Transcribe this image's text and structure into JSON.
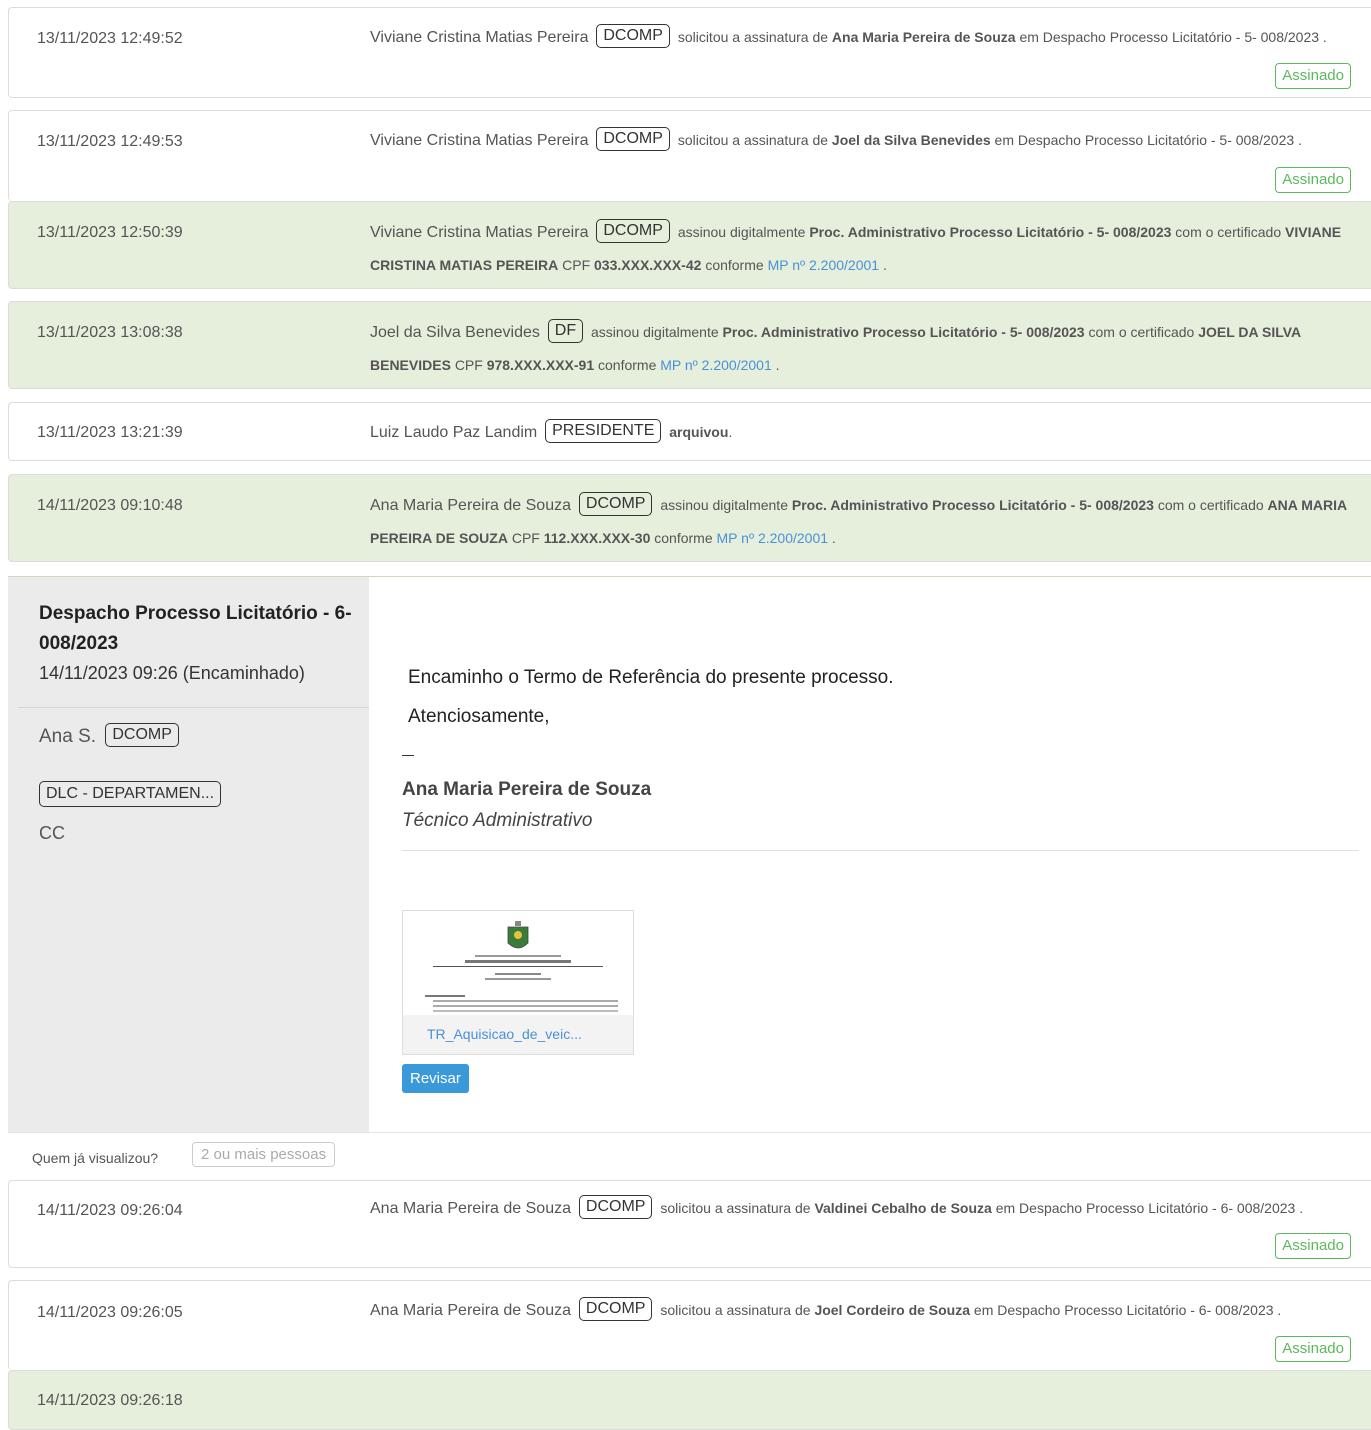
{
  "rows_top": [
    {
      "date": "13/11/2023 12:49:52",
      "name": "Viviane Cristina Matias Pereira",
      "tag": "DCOMP",
      "text1": "solicitou a assinatura de",
      "bold1": "Ana Maria Pereira de Souza",
      "text2": "em Despacho Processo Licitatório - 5- 008/2023 .",
      "badge": "Assinado"
    },
    {
      "date": "13/11/2023 12:49:53",
      "name": "Viviane Cristina Matias Pereira",
      "tag": "DCOMP",
      "text1": "solicitou a assinatura de",
      "bold1": "Joel da Silva Benevides",
      "text2": "em Despacho Processo Licitatório - 5- 008/2023 .",
      "badge": "Assinado"
    },
    {
      "date": "13/11/2023 12:50:39",
      "name": "Viviane Cristina Matias Pereira",
      "tag": "DCOMP",
      "text1": "assinou digitalmente",
      "bold1": "Proc. Administrativo Processo Licitatório - 5- 008/2023",
      "text2": "com o certificado",
      "bold2": "VIVIANE CRISTINA MATIAS PEREIRA",
      "text3": "CPF",
      "bold3": "033.XXX.XXX-42",
      "text4": "conforme",
      "link": "MP nº 2.200/2001",
      "text5": "."
    },
    {
      "date": "13/11/2023 13:08:38",
      "name": "Joel da Silva Benevides",
      "tag": "DF",
      "text1": "assinou digitalmente",
      "bold1": "Proc. Administrativo Processo Licitatório - 5- 008/2023",
      "text2": "com o certificado",
      "bold2": "JOEL DA SILVA BENEVIDES",
      "text3": "CPF",
      "bold3": "978.XXX.XXX-91",
      "text4": "conforme",
      "link": "MP nº 2.200/2001",
      "text5": "."
    },
    {
      "date": "13/11/2023 13:21:39",
      "name": "Luiz Laudo Paz Landim",
      "tag": "PRESIDENTE",
      "bold1": "arquivou",
      "text2": "."
    },
    {
      "date": "14/11/2023 09:10:48",
      "name": "Ana Maria Pereira de Souza",
      "tag": "DCOMP",
      "text1": "assinou digitalmente",
      "bold1": "Proc. Administrativo Processo Licitatório - 5- 008/2023",
      "text2": "com o certificado",
      "bold2": "ANA MARIA PEREIRA DE SOUZA",
      "text3": "CPF",
      "bold3": "112.XXX.XXX-30",
      "text4": "conforme",
      "link": "MP nº 2.200/2001",
      "text5": "."
    }
  ],
  "card": {
    "title": "Despacho Processo Licitatório - 6- 008/2023",
    "datetime": "14/11/2023 09:26 (Encaminhado)",
    "author": "Ana S.",
    "author_tag": "DCOMP",
    "dept": "DLC - DEPARTAMEN...",
    "cc": "CC",
    "para1": "Encaminho o Termo de Referência do presente processo.",
    "para2": "Atenciosamente,",
    "sig_name": "Ana Maria Pereira de Souza",
    "sig_role": "Técnico Administrativo",
    "attachment": "TR_Aquisicao_de_veic...",
    "review_button": "Revisar"
  },
  "viewed": {
    "label": "Quem já visualizou?",
    "button": "2 ou mais pessoas"
  },
  "rows_bottom": [
    {
      "date": "14/11/2023 09:26:04",
      "name": "Ana Maria Pereira de Souza",
      "tag": "DCOMP",
      "text1": "solicitou a assinatura de",
      "bold1": "Valdinei Cebalho de Souza",
      "text2": "em Despacho Processo Licitatório - 6- 008/2023 .",
      "badge": "Assinado"
    },
    {
      "date": "14/11/2023 09:26:05",
      "name": "Ana Maria Pereira de Souza",
      "tag": "DCOMP",
      "text1": "solicitou a assinatura de",
      "bold1": "Joel Cordeiro de Souza",
      "text2": "em Despacho Processo Licitatório - 6- 008/2023 .",
      "badge": "Assinado"
    },
    {
      "date": "14/11/2023 09:26:18"
    }
  ],
  "colors": {
    "green_row": "#e5efdc",
    "badge": "#5cb85c",
    "link": "#4a90d9",
    "button": "#3a9ad9"
  }
}
